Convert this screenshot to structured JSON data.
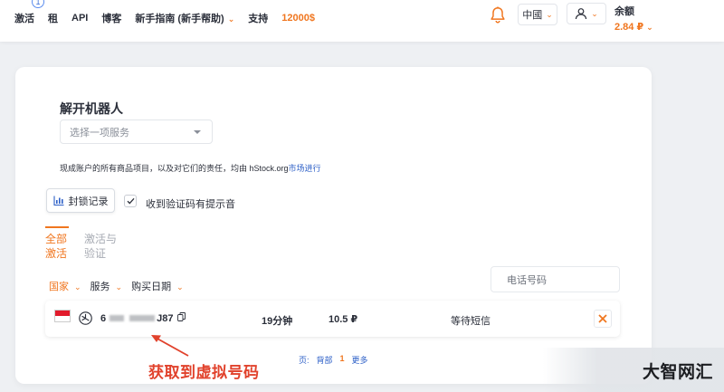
{
  "header": {
    "nav": [
      {
        "label": "激活",
        "badge": "1"
      },
      {
        "label": "租"
      },
      {
        "label": "API"
      },
      {
        "label": "博客"
      },
      {
        "label": "新手指南 (新手帮助)",
        "dropdown": true
      },
      {
        "label": "支持"
      },
      {
        "label": "12000$",
        "accent": true
      }
    ],
    "language": "中國",
    "balance_label": "余额",
    "balance_value": "2.84 ₽"
  },
  "main": {
    "title": "解开机器人",
    "service_select_placeholder": "选择一项服务",
    "notice_text": "现成账户的所有商品项目，以及对它们的责任，均由 hStock.org",
    "notice_link": "市场进行",
    "lock_button": "封锁记录",
    "sound_checkbox_label": "收到验证码有提示音",
    "tabs": [
      {
        "label": "全部激活",
        "active": true
      },
      {
        "label": "激活与验证",
        "active": false
      }
    ],
    "filters": [
      "国家",
      "服务",
      "购买日期"
    ],
    "phone_placeholder": "电话号码",
    "rows": [
      {
        "phone_prefix": "6",
        "phone_suffix": "J87",
        "duration": "19分钟",
        "price": "10.5 ₽",
        "status": "等待短信"
      }
    ],
    "pager": {
      "label": "页:",
      "back": "背部",
      "current": "1",
      "more": "更多"
    }
  },
  "annotation": "获取到虚拟号码",
  "watermark": "大智网汇",
  "colors": {
    "accent": "#f0761f",
    "link": "#2c5fc7",
    "annotation": "#e1422c"
  }
}
